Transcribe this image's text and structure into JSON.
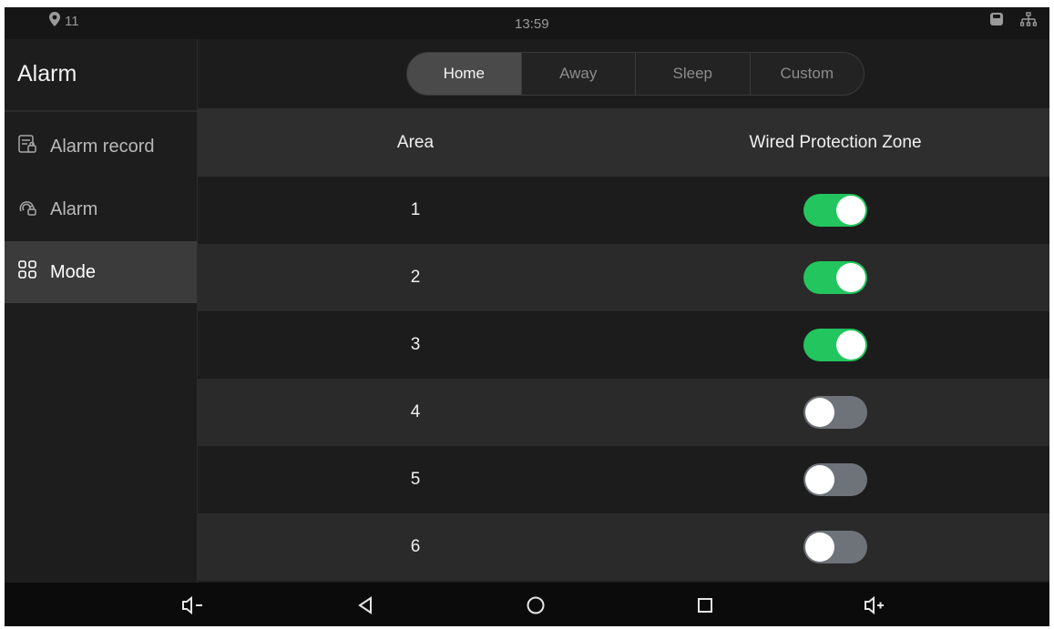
{
  "status_bar": {
    "location_count": "11",
    "time": "13:59",
    "icons": [
      "location-pin-icon",
      "sd-card-icon",
      "network-icon"
    ]
  },
  "sidebar": {
    "title": "Alarm",
    "items": [
      {
        "label": "Alarm record",
        "icon": "alarm-record-icon",
        "active": false
      },
      {
        "label": "Alarm",
        "icon": "alarm-icon",
        "active": false
      },
      {
        "label": "Mode",
        "icon": "mode-grid-icon",
        "active": true
      }
    ]
  },
  "mode_tabs": [
    {
      "label": "Home",
      "active": true
    },
    {
      "label": "Away",
      "active": false
    },
    {
      "label": "Sleep",
      "active": false
    },
    {
      "label": "Custom",
      "active": false
    }
  ],
  "table": {
    "headers": {
      "area": "Area",
      "zone": "Wired Protection Zone"
    },
    "rows": [
      {
        "area": "1",
        "enabled": true
      },
      {
        "area": "2",
        "enabled": true
      },
      {
        "area": "3",
        "enabled": true
      },
      {
        "area": "4",
        "enabled": false
      },
      {
        "area": "5",
        "enabled": false
      },
      {
        "area": "6",
        "enabled": false
      }
    ]
  },
  "nav_bar": [
    "volume-down-icon",
    "back-icon",
    "home-icon",
    "recents-icon",
    "volume-up-icon"
  ],
  "colors": {
    "toggle_on": "#22c55e",
    "toggle_off": "#6e737a",
    "active_bg": "#3b3b3b"
  }
}
